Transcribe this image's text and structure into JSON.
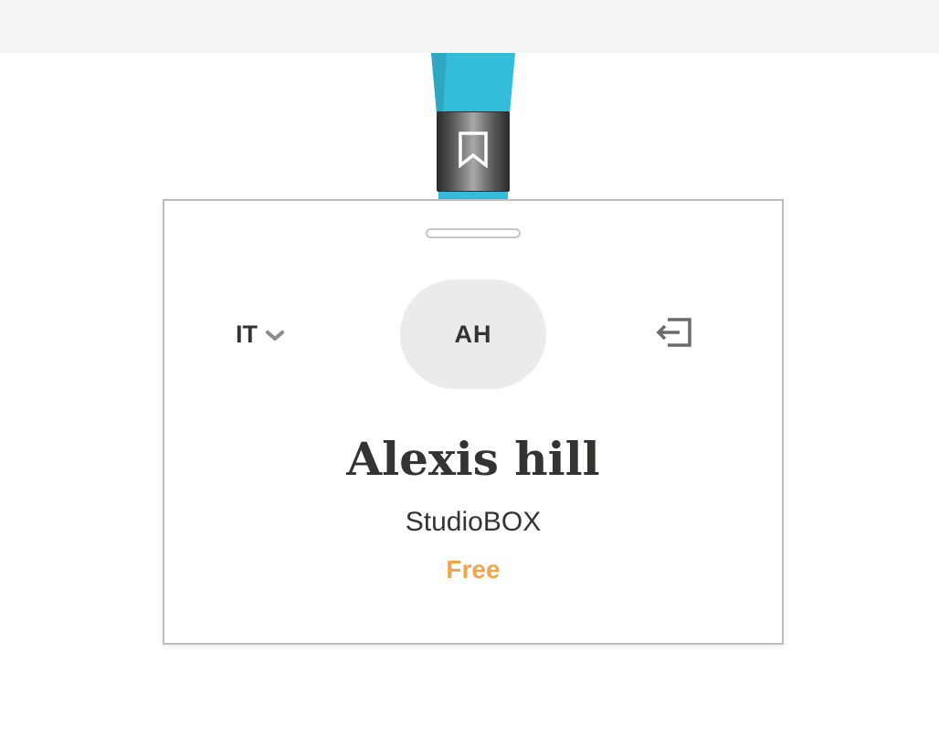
{
  "badge": {
    "language": {
      "selected": "IT",
      "icon": "chevron-down-icon"
    },
    "avatar": {
      "initials": "AH"
    },
    "logout": {
      "icon": "logout-icon"
    },
    "user": {
      "name": "Alexis hill",
      "organization": "StudioBOX",
      "plan": "Free"
    },
    "clip_icon": "bookmark-icon"
  },
  "colors": {
    "lanyard": "#34bcdb",
    "plan": "#f0a54d",
    "text": "#333330",
    "avatar_bg": "#ebebe9",
    "top_bar": "#f4f4f4"
  }
}
